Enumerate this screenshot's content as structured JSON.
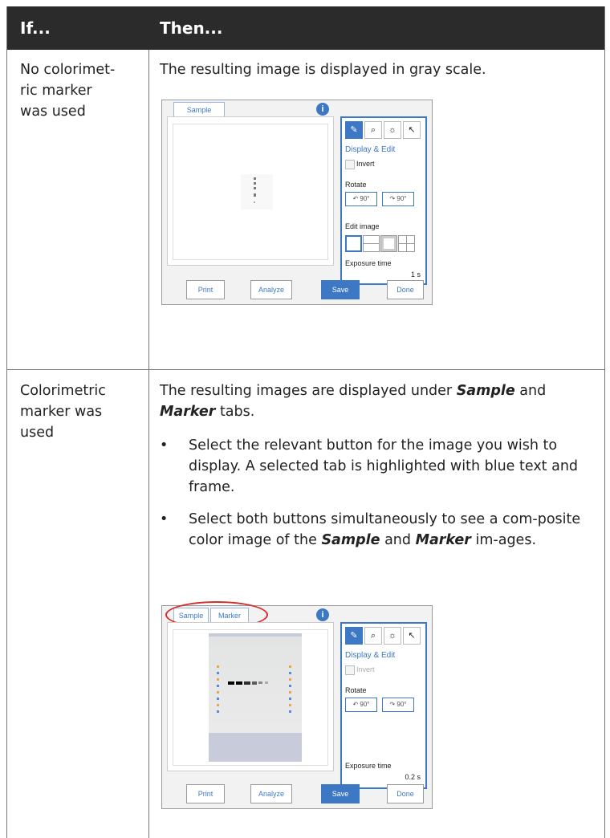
{
  "header": {
    "col_if": "If...",
    "col_then": "Then..."
  },
  "rows": [
    {
      "if_lines": [
        "No colorimet-",
        "ric marker",
        "was used"
      ],
      "then_text": "The resulting image is displayed in gray scale.",
      "screenshot": {
        "tabs": [
          "Sample"
        ],
        "info_icon": "i",
        "panel_title": "Display & Edit",
        "invert_label": "Invert",
        "rotate_label": "Rotate",
        "rotate_left": "90°",
        "rotate_right": "90°",
        "edit_image_label": "Edit image",
        "exposure_label": "Exposure time",
        "exposure_value": "1 s",
        "buttons": {
          "print": "Print",
          "analyze": "Analyze",
          "save": "Save",
          "done": "Done"
        }
      }
    },
    {
      "if_lines": [
        "Colorimetric",
        "marker was",
        "used"
      ],
      "then_pre": "The resulting images are displayed under ",
      "then_b1": "Sample",
      "then_mid": " and",
      "then_b2": "Marker",
      "then_post": " tabs.",
      "bullet1": "Select the relevant button for the image you wish to display. A selected tab is highlighted with blue text and frame.",
      "bullet2_pre": "Select both buttons simultaneously to see a com-posite color image of the ",
      "bullet2_b1": "Sample",
      "bullet2_mid": " and ",
      "bullet2_b2": "Marker",
      "bullet2_post": " im-ages.",
      "screenshot": {
        "tabs": [
          "Sample",
          "Marker"
        ],
        "info_icon": "i",
        "panel_title": "Display & Edit",
        "invert_label": "Invert",
        "rotate_label": "Rotate",
        "rotate_left": "90°",
        "rotate_right": "90°",
        "exposure_label": "Exposure time",
        "exposure_value": "0.2 s",
        "buttons": {
          "print": "Print",
          "analyze": "Analyze",
          "save": "Save",
          "done": "Done"
        }
      }
    }
  ],
  "colors": {
    "header_bg": "#2b2b2b",
    "accent": "#3c78c3",
    "highlight_ring": "#d62b2b"
  },
  "icons": [
    "edit-icon",
    "zoom-icon",
    "brightness-icon",
    "pipette-icon",
    "rotate-left-icon",
    "rotate-right-icon",
    "info-icon"
  ]
}
